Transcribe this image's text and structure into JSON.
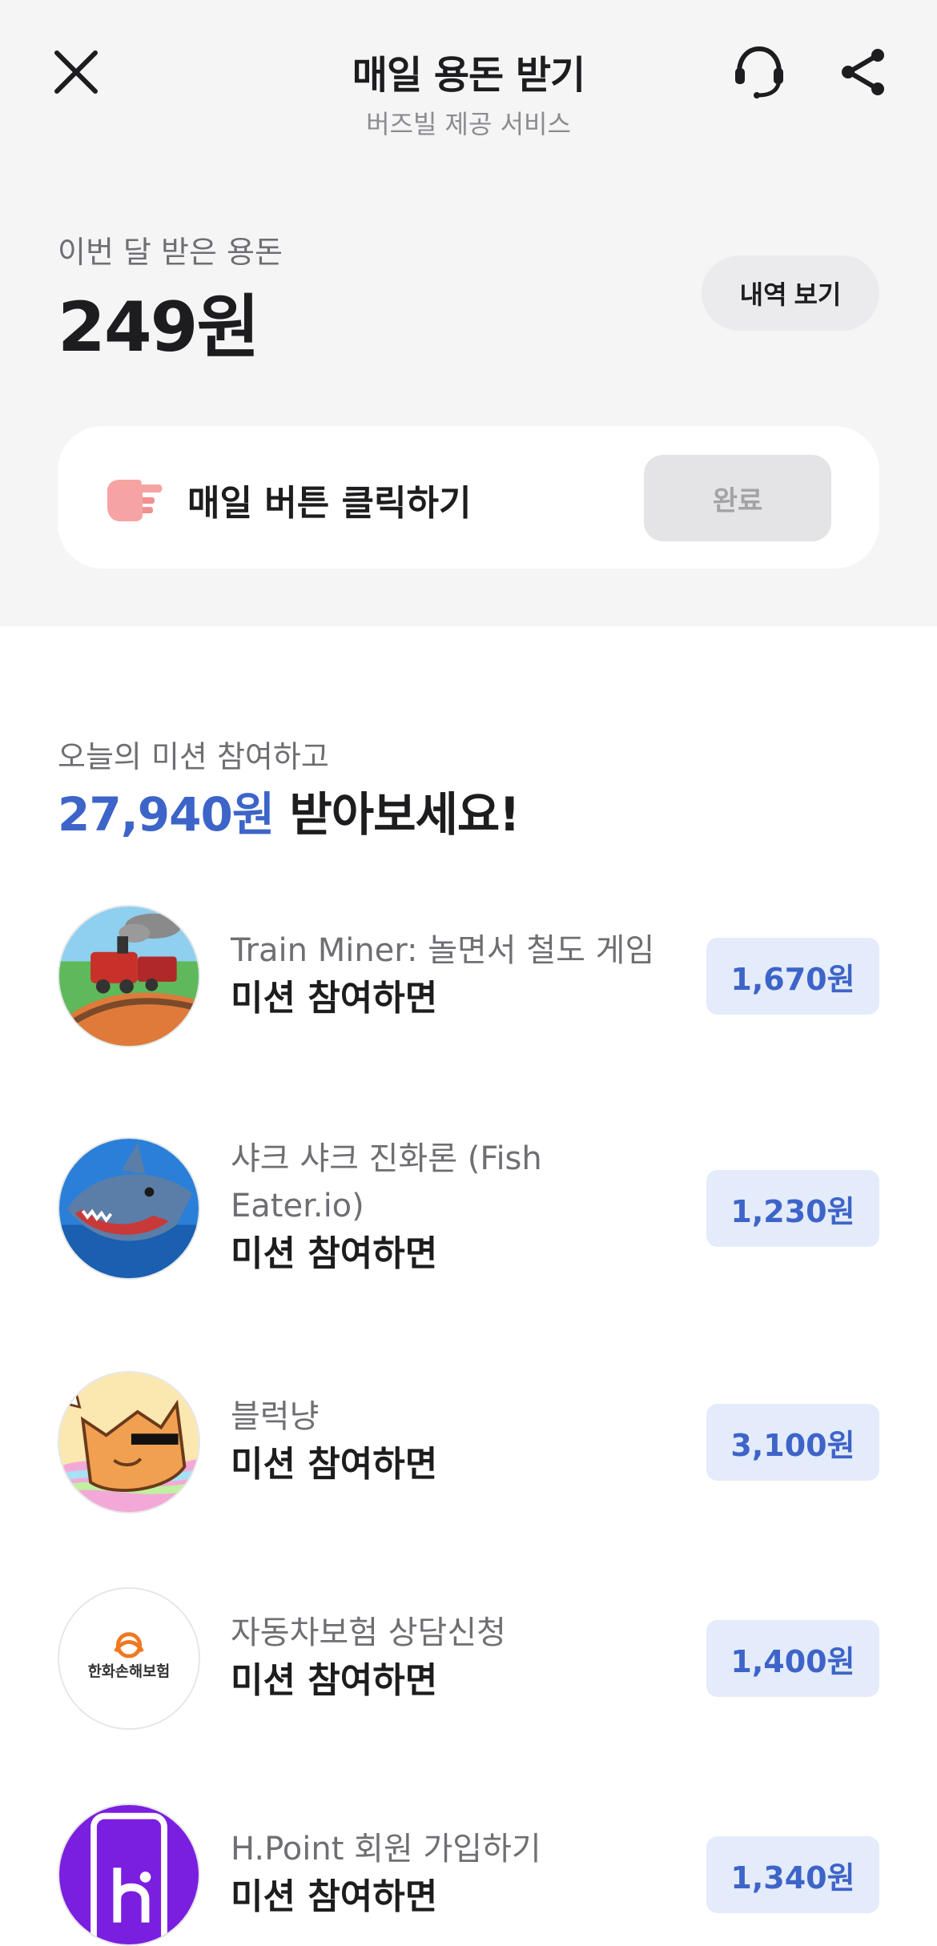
{
  "header": {
    "title": "매일 용돈 받기",
    "subtitle": "버즈빌 제공 서비스",
    "close_icon": "close-icon",
    "support_icon": "headset-icon",
    "share_icon": "share-icon"
  },
  "summary": {
    "label": "이번 달 받은 용돈",
    "amount": "249원",
    "history_button": "내역 보기"
  },
  "daily": {
    "icon": "pointing-hand-icon",
    "label": "매일 버튼 클릭하기",
    "button": "완료"
  },
  "missions": {
    "intro": "오늘의 미션 참여하고",
    "total_amount": "27,940원",
    "headline_suffix": " 받아보세요!",
    "items": [
      {
        "title": "Train Miner: 놀면서 철도 게임",
        "subtitle": "미션 참여하면",
        "reward": "1,670원",
        "icon": "train-game-icon"
      },
      {
        "title": "샤크 샤크 진화론 (Fish Eater.io)",
        "subtitle": "미션 참여하면",
        "reward": "1,230원",
        "icon": "shark-game-icon"
      },
      {
        "title": "블럭냥",
        "subtitle": "미션 참여하면",
        "reward": "3,100원",
        "icon": "cat-game-icon"
      },
      {
        "title": "자동차보험 상담신청",
        "subtitle": "미션 참여하면",
        "reward": "1,400원",
        "icon": "insurance-logo-icon",
        "logo_text": "한화손해보험"
      },
      {
        "title": "H.Point 회원 가입하기",
        "subtitle": "미션 참여하면",
        "reward": "1,340원",
        "icon": "hpoint-app-icon"
      }
    ]
  },
  "colors": {
    "accent": "#3d64c8",
    "reward_bg": "#e4ebfa",
    "top_bg": "#f5f5f6"
  }
}
